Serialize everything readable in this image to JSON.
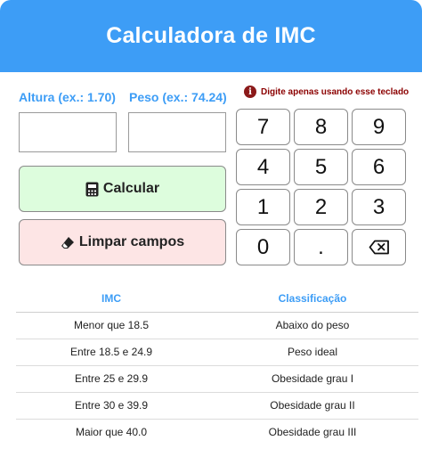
{
  "header": {
    "title": "Calculadora de IMC"
  },
  "form": {
    "altura_label": "Altura (ex.: 1.70)",
    "peso_label": "Peso (ex.: 74.24)",
    "altura_value": "",
    "peso_value": ""
  },
  "warning": {
    "icon": "info-icon",
    "text": "Digite apenas usando esse teclado"
  },
  "buttons": {
    "calcular": {
      "label": "Calcular",
      "icon": "calculator-icon"
    },
    "limpar": {
      "label": "Limpar campos",
      "icon": "eraser-icon"
    }
  },
  "keypad": {
    "keys": [
      "7",
      "8",
      "9",
      "4",
      "5",
      "6",
      "1",
      "2",
      "3",
      "0",
      ".",
      ""
    ],
    "backspace_icon": "backspace-icon"
  },
  "table": {
    "headers": [
      "IMC",
      "Classificação"
    ],
    "rows": [
      [
        "Menor que 18.5",
        "Abaixo do peso"
      ],
      [
        "Entre 18.5 e 24.9",
        "Peso ideal"
      ],
      [
        "Entre 25 e 29.9",
        "Obesidade grau I"
      ],
      [
        "Entre 30 e 39.9",
        "Obesidade grau II"
      ],
      [
        "Maior que 40.0",
        "Obesidade grau III"
      ]
    ]
  },
  "colors": {
    "header": "#3d9df6",
    "accent": "#3d9df6",
    "warning": "#8b0000",
    "calc_button": "#ddfddd",
    "clear_button": "#fde5e5"
  }
}
